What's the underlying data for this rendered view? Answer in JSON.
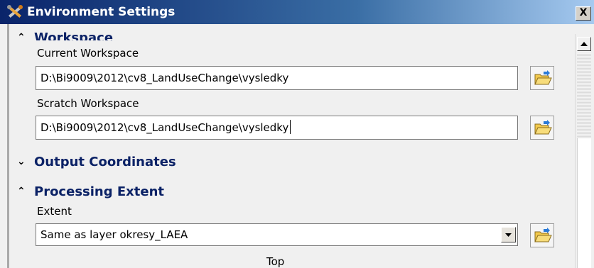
{
  "window": {
    "title": "Environment Settings",
    "close_label": "X",
    "title_gradient_start": "#0a246a",
    "title_gradient_end": "#a6caf0"
  },
  "sections": {
    "workspace": {
      "title": "Workspace",
      "expanded": true,
      "chevron": "⌃",
      "current_label": "Current Workspace",
      "current_value": "D:\\Bi9009\\2012\\cv8_LandUseChange\\vysledky",
      "scratch_label": "Scratch Workspace",
      "scratch_value": "D:\\Bi9009\\2012\\cv8_LandUseChange\\vysledky"
    },
    "output_coordinates": {
      "title": "Output Coordinates",
      "expanded": false,
      "chevron": "⌄"
    },
    "processing_extent": {
      "title": "Processing Extent",
      "expanded": true,
      "chevron": "⌃",
      "extent_label": "Extent",
      "extent_value": "Same as layer okresy_LAEA",
      "top_label": "Top"
    }
  },
  "icons": {
    "app": "tools-icon",
    "browse": "folder-open-icon",
    "dropdown": "chevron-down-icon",
    "scroll_up": "scroll-up-arrow-icon"
  }
}
